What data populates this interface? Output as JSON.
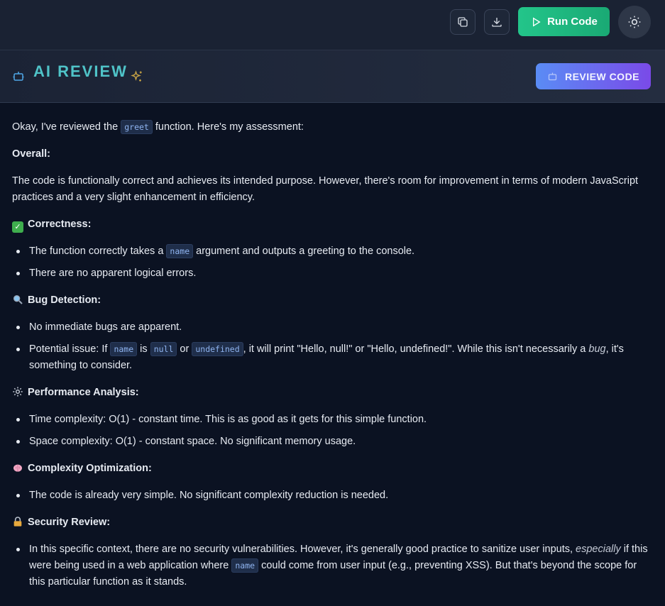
{
  "toolbar": {
    "copy_icon": "copy-icon",
    "download_icon": "download-icon",
    "run_label": "Run Code",
    "theme_icon": "sun-icon"
  },
  "review": {
    "title": "AI REVIEW",
    "button_label": "REVIEW CODE"
  },
  "content": {
    "intro_pre": "Okay, I've reviewed the ",
    "intro_code": "greet",
    "intro_post": " function. Here's my assessment:",
    "overall_heading": "Overall:",
    "overall_text": "The code is functionally correct and achieves its intended purpose. However, there's room for improvement in terms of modern JavaScript practices and a very slight enhancement in efficiency.",
    "correctness_heading": "Correctness:",
    "correctness_1_pre": "The function correctly takes a ",
    "correctness_1_code": "name",
    "correctness_1_post": " argument and outputs a greeting to the console.",
    "correctness_2": "There are no apparent logical errors.",
    "bug_heading": "Bug Detection:",
    "bug_1": "No immediate bugs are apparent.",
    "bug_2_a": "Potential issue: If ",
    "bug_2_code1": "name",
    "bug_2_b": " is ",
    "bug_2_code2": "null",
    "bug_2_c": " or ",
    "bug_2_code3": "undefined",
    "bug_2_d": ", it will print \"Hello, null!\" or \"Hello, undefined!\". While this isn't necessarily a ",
    "bug_2_em": "bug",
    "bug_2_e": ", it's something to consider.",
    "perf_heading": "Performance Analysis:",
    "perf_1": "Time complexity: O(1) - constant time. This is as good as it gets for this simple function.",
    "perf_2": "Space complexity: O(1) - constant space. No significant memory usage.",
    "complexity_heading": "Complexity Optimization:",
    "complexity_1": "The code is already very simple. No significant complexity reduction is needed.",
    "security_heading": "Security Review:",
    "security_1_a": "In this specific context, there are no security vulnerabilities. However, it's generally good practice to sanitize user inputs, ",
    "security_1_em": "especially",
    "security_1_b": " if this were being used in a web application where ",
    "security_1_code": "name",
    "security_1_c": " could come from user input (e.g., preventing XSS). But that's beyond the scope for this particular function as it stands."
  },
  "colors": {
    "accent_green": "#23c58a",
    "title_teal": "#4fc3c8",
    "review_gradient_start": "#5a8cf5",
    "review_gradient_end": "#7a4ae8"
  }
}
